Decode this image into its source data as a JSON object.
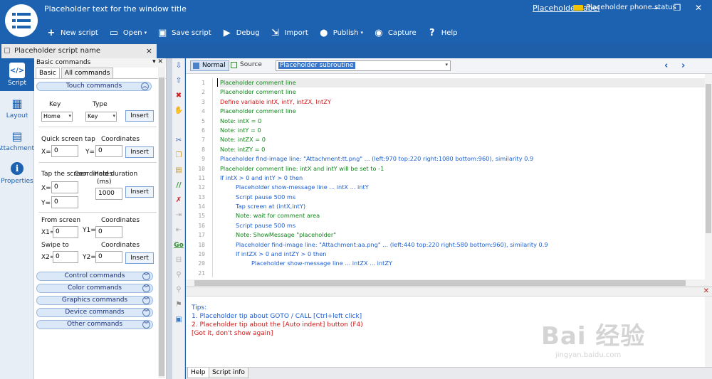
{
  "window": {
    "title": "Placeholder text for the window title",
    "author_link": "Placeholder label",
    "phone_status": "Placeholder phone status",
    "controls": {
      "minimize": "—",
      "maximize": "❐",
      "close": "✕"
    }
  },
  "toolbar": [
    {
      "label": "New script",
      "icon": "plus-icon",
      "glyph": "+"
    },
    {
      "label": "Open",
      "icon": "folder-icon",
      "glyph": "▭"
    },
    {
      "label": "Save script",
      "icon": "save-icon",
      "glyph": "▣"
    },
    {
      "label": "Debug",
      "icon": "play-icon",
      "glyph": "▶"
    },
    {
      "label": "Import",
      "icon": "import-icon",
      "glyph": "⇲"
    },
    {
      "label": "Publish",
      "icon": "publish-icon",
      "glyph": "●"
    },
    {
      "label": "Capture",
      "icon": "camera-icon",
      "glyph": "◉"
    },
    {
      "label": "Help",
      "icon": "help-icon",
      "glyph": "?"
    }
  ],
  "document_tab": {
    "label": "Placeholder script name",
    "close": "×"
  },
  "rail": [
    {
      "label": "Script",
      "icon": "script-icon"
    },
    {
      "label": "Layout",
      "icon": "grid-icon"
    },
    {
      "label": "Attachments",
      "icon": "attachment-icon"
    },
    {
      "label": "Properties",
      "icon": "info-icon"
    }
  ],
  "panel": {
    "title": "Basic commands",
    "pin": "▾ ✕",
    "tabs": [
      "Basic",
      "All commands"
    ],
    "sections": {
      "touch": "Touch commands",
      "control": "Control commands",
      "color": "Color commands",
      "graphics": "Graphics commands",
      "device": "Device commands",
      "other": "Other commands"
    },
    "chev_up": "︽",
    "chev_down": "︾",
    "key_label": "Key",
    "type_label": "Type",
    "key_value": "Home",
    "type_value": "Key",
    "insert": "Insert",
    "tap_label": "Quick screen tap",
    "coord_label": "Coordinates",
    "x_label": "X=",
    "y_label": "Y=",
    "x_value": "0",
    "y_value": "0",
    "hold_label": "Tap the screen",
    "hold_coord": "Coordinates",
    "duration_label": "Hold duration",
    "duration_unit": "(ms)",
    "duration_value": "1000",
    "swipe_from": "From screen",
    "swipe_to": "Swipe to",
    "x1_label": "X1=",
    "y1_label": "Y1=",
    "x2_label": "X2=",
    "y2_label": "Y2=",
    "x1_value": "0",
    "y1_value": "0",
    "x2_value": "0",
    "y2_value": "0"
  },
  "editor_bar": {
    "mode_normal": "Normal",
    "mode_source": "Source",
    "subroutine": "Placeholder subroutine",
    "nav_prev": "‹",
    "nav_next": "›"
  },
  "code": {
    "line_numbers": [
      "1",
      "2",
      "3",
      "4",
      "5",
      "6",
      "7",
      "8",
      "9",
      "10",
      "11",
      "12",
      "13",
      "14",
      "15",
      "16",
      "17",
      "18",
      "19",
      "20",
      "21"
    ],
    "lines": [
      {
        "text": "Placeholder comment line",
        "cls": "c-cm",
        "indent": 0
      },
      {
        "text": "Placeholder comment line",
        "cls": "c-cm",
        "indent": 0
      },
      {
        "text": "Define variable intX, intY, intZX, IntZY",
        "cls": "c-kw",
        "indent": 0
      },
      {
        "text": "Placeholder comment line",
        "cls": "c-cm",
        "indent": 0
      },
      {
        "text": "Note: intX = 0",
        "cls": "c-cm",
        "indent": 0
      },
      {
        "text": "Note: intY = 0",
        "cls": "c-cm",
        "indent": 0
      },
      {
        "text": "Note: intZX = 0",
        "cls": "c-cm",
        "indent": 0
      },
      {
        "text": "Note: intZY = 0",
        "cls": "c-cm",
        "indent": 0
      },
      {
        "text": "Placeholder find-image line: \"Attachment:tt.png\" ... (left:970 top:220 right:1080 bottom:960), similarity 0.9",
        "cls": "c-bl",
        "indent": 0
      },
      {
        "text": "Placeholder comment line: intX and intY will be set to -1",
        "cls": "c-cm",
        "indent": 0
      },
      {
        "text": "If intX > 0 and intY > 0 then",
        "cls": "c-bl",
        "indent": 0
      },
      {
        "text": "Placeholder show-message line ... intX ... intY",
        "cls": "c-bl",
        "indent": 1
      },
      {
        "text": "Script pause 500 ms",
        "cls": "c-bl",
        "indent": 1
      },
      {
        "text": "Tap screen at (intX,intY)",
        "cls": "c-bl",
        "indent": 1
      },
      {
        "text": "Note: wait for comment area",
        "cls": "c-cm",
        "indent": 1
      },
      {
        "text": "Script pause 500 ms",
        "cls": "c-bl",
        "indent": 1
      },
      {
        "text": "Note: ShowMessage \"placeholder\"",
        "cls": "c-cm",
        "indent": 1
      },
      {
        "text": "Placeholder find-image line: \"Attachment:aa.png\" ... (left:440 top:220 right:580 bottom:960), similarity 0.9",
        "cls": "c-bl",
        "indent": 1
      },
      {
        "text": "If intZX > 0 and intZY > 0 then",
        "cls": "c-bl",
        "indent": 1
      },
      {
        "text": "Placeholder show-message line ... intZX ... intZY",
        "cls": "c-bl",
        "indent": 2
      },
      {
        "text": "",
        "cls": "c-bl",
        "indent": 0
      }
    ]
  },
  "help": {
    "close": "✕",
    "lines": [
      {
        "text": "Tips:",
        "cls": "c-bl"
      },
      {
        "text": "1. Placeholder tip about GOTO / CALL [Ctrl+left click]",
        "cls": "c-bl"
      },
      {
        "text": "2. Placeholder tip about the [Auto indent] button (F4)",
        "cls": "c-kw"
      },
      {
        "text": "[Got it, don't show again]",
        "cls": "c-kw"
      }
    ],
    "tabs": [
      "Help",
      "Script info"
    ]
  },
  "watermark": {
    "big": "Bai 经验",
    "small": "jingyan.baidu.com"
  },
  "colors": {
    "brand_blue": "#1d62b0",
    "comment": "#10851a",
    "keyword": "#d01a1a",
    "statement": "#1d5fd0"
  }
}
